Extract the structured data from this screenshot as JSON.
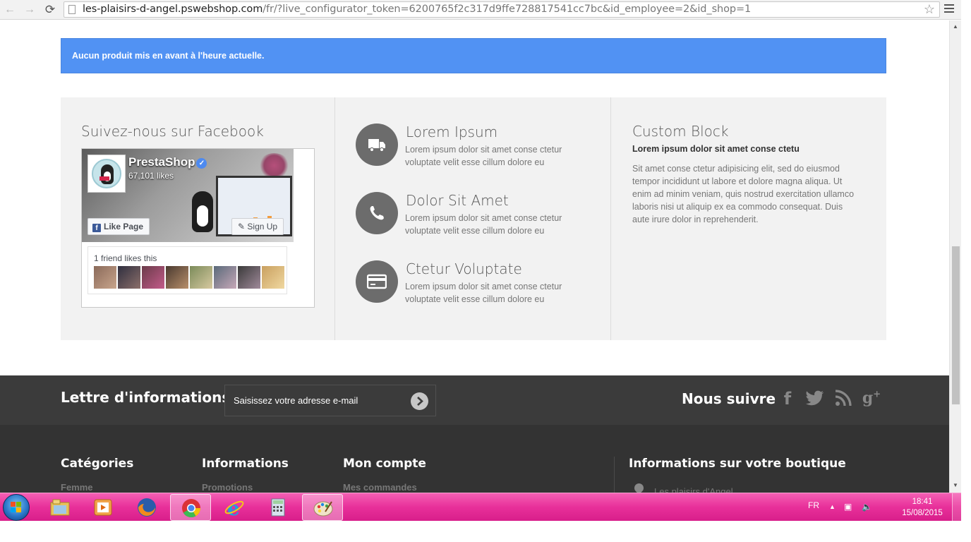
{
  "browser": {
    "url_host": "les-plaisirs-d-angel.pswebshop.com",
    "url_path": "/fr/?live_configurator_token=6200765f2c317d9ffe728817541cc7bc&id_employee=2&id_shop=1"
  },
  "alert": {
    "text": "Aucun produit mis en avant à l'heure actuelle.",
    "color": "#5192f3"
  },
  "facebook": {
    "title": "Suivez-nous sur Facebook",
    "page_name": "PrestaShop",
    "likes": "67,101 likes",
    "like_button": "Like Page",
    "signup_button": "Sign Up",
    "friends_text": "1 friend likes this"
  },
  "info_blocks": [
    {
      "title": "Lorem Ipsum",
      "text": "Lorem ipsum dolor sit amet conse ctetur voluptate velit esse cillum dolore eu",
      "icon": "truck-icon"
    },
    {
      "title": "Dolor Sit Amet",
      "text": "Lorem ipsum dolor sit amet conse ctetur voluptate velit esse cillum dolore eu",
      "icon": "phone-icon"
    },
    {
      "title": "Ctetur Voluptate",
      "text": "Lorem ipsum dolor sit amet conse ctetur voluptate velit esse cillum dolore eu",
      "icon": "credit-card-icon"
    }
  ],
  "custom_block": {
    "title": "Custom Block",
    "subtitle": "Lorem ipsum dolor sit amet conse ctetu",
    "text": "Sit amet conse ctetur adipisicing elit, sed do eiusmod tempor incididunt ut labore et dolore magna aliqua. Ut enim ad minim veniam, quis nostrud exercitation ullamco laboris nisi ut aliquip ex ea commodo consequat. Duis aute irure dolor in reprehenderit."
  },
  "newsletter": {
    "title": "Lettre d'informations",
    "input_text": "Saisissez votre adresse e-mail"
  },
  "social": {
    "title": "Nous suivre",
    "icons": [
      "facebook-icon",
      "twitter-icon",
      "rss-icon",
      "google-plus-icon"
    ]
  },
  "footer": {
    "columns": [
      {
        "title": "Catégories",
        "first_link": "Femme"
      },
      {
        "title": "Informations",
        "first_link": "Promotions"
      },
      {
        "title": "Mon compte",
        "first_link": "Mes commandes"
      }
    ],
    "store_title": "Informations sur votre boutique",
    "store_name": "Les plaisirs d'Angel"
  },
  "taskbar": {
    "apps": [
      "explorer-icon",
      "media-player-icon",
      "firefox-icon",
      "chrome-icon",
      "internet-explorer-icon",
      "calculator-icon",
      "paint-icon"
    ],
    "active": [
      "chrome-icon",
      "paint-icon"
    ],
    "language": "FR",
    "time": "18:41",
    "date": "15/08/2015"
  }
}
